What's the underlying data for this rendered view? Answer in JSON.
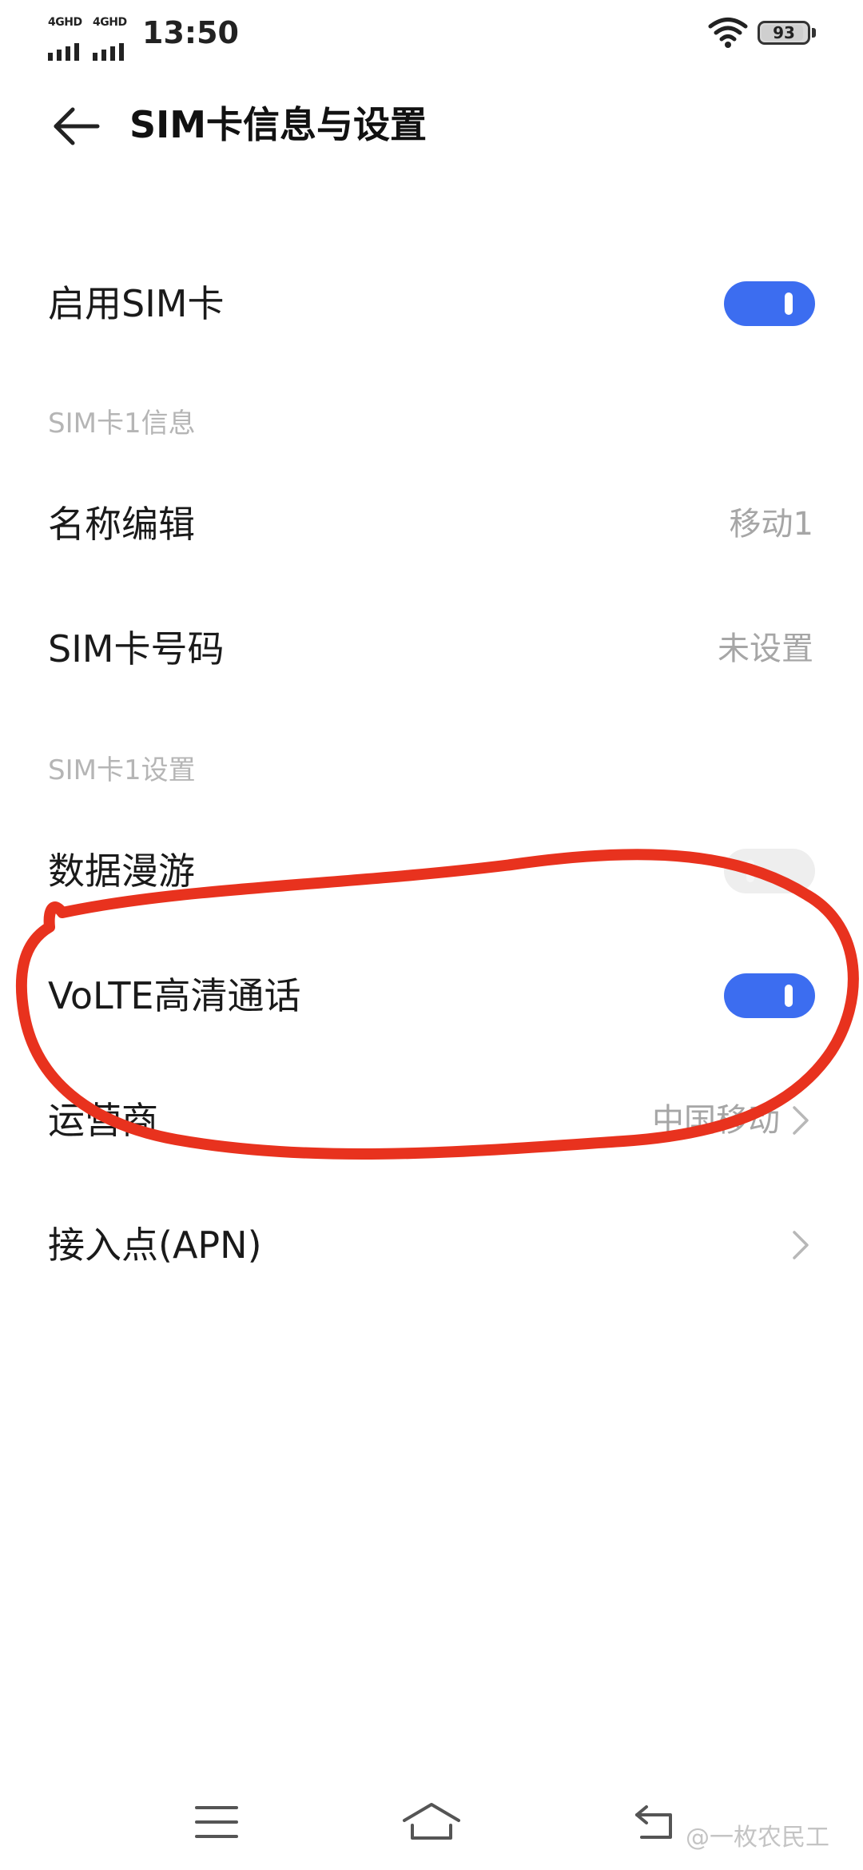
{
  "status_bar": {
    "sim1_network": "4GHD",
    "sim2_network": "4GHD",
    "time": "13:50",
    "battery_level": "93",
    "icons": [
      "signal-icon",
      "wifi-icon",
      "battery-icon"
    ]
  },
  "header": {
    "title": "SIM卡信息与设置",
    "back_icon": "back-arrow-icon"
  },
  "enable_sim": {
    "label": "启用SIM卡",
    "enabled": true
  },
  "section_info": {
    "label": "SIM卡1信息"
  },
  "name_edit": {
    "label": "名称编辑",
    "value": "移动1"
  },
  "sim_number": {
    "label": "SIM卡号码",
    "value": "未设置"
  },
  "section_settings": {
    "label": "SIM卡1设置"
  },
  "data_roaming": {
    "label": "数据漫游",
    "enabled": false
  },
  "volte": {
    "label": "VoLTE高清通话",
    "enabled": true
  },
  "carrier": {
    "label": "运营商",
    "value": "中国移动"
  },
  "apn": {
    "label": "接入点(APN)"
  },
  "nav_bar": {
    "icons": [
      "menu-icon",
      "home-icon",
      "back-icon"
    ]
  },
  "watermark": {
    "text": "@一枚农民工"
  },
  "colors": {
    "toggle_on": "#3c6df0",
    "toggle_off": "#eeeeee",
    "annotation": "#e8321e",
    "secondary_text": "#a6a6a6"
  }
}
